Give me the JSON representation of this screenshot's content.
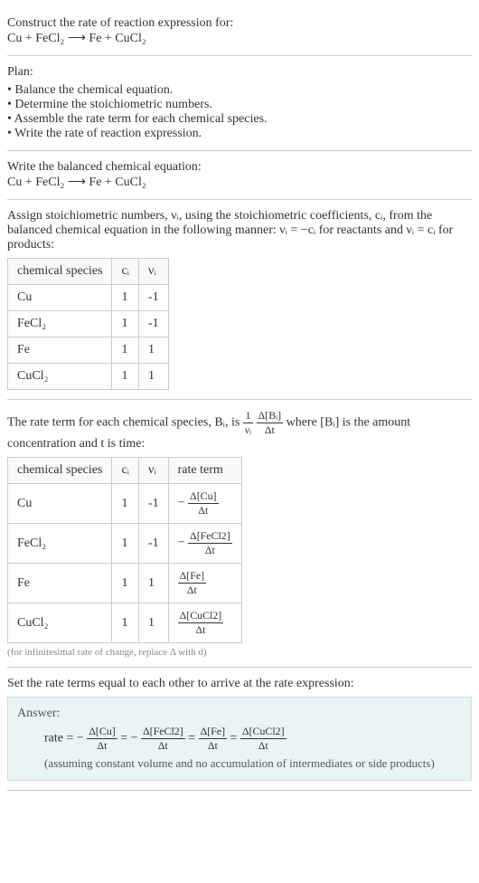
{
  "s1": {
    "title": "Construct the rate of reaction expression for:",
    "eq": "Cu + FeCl₂ ⟶ Fe + CuCl₂"
  },
  "s2": {
    "title": "Plan:",
    "items": [
      "Balance the chemical equation.",
      "Determine the stoichiometric numbers.",
      "Assemble the rate term for each chemical species.",
      "Write the rate of reaction expression."
    ]
  },
  "s3": {
    "title": "Write the balanced chemical equation:",
    "eq": "Cu + FeCl₂ ⟶ Fe + CuCl₂"
  },
  "s4": {
    "intro_a": "Assign stoichiometric numbers, νᵢ, using the stoichiometric coefficients, cᵢ, from the balanced chemical equation in the following manner: νᵢ = −cᵢ for reactants and νᵢ = cᵢ for products:",
    "headers": {
      "h1": "chemical species",
      "h2": "cᵢ",
      "h3": "νᵢ"
    },
    "rows": [
      {
        "sp": "Cu",
        "c": "1",
        "v": "-1"
      },
      {
        "sp": "FeCl₂",
        "c": "1",
        "v": "-1"
      },
      {
        "sp": "Fe",
        "c": "1",
        "v": "1"
      },
      {
        "sp": "CuCl₂",
        "c": "1",
        "v": "1"
      }
    ]
  },
  "s5": {
    "intro_a": "The rate term for each chemical species, Bᵢ, is ",
    "one_over_v_num": "1",
    "one_over_v_den": "νᵢ",
    "dB_num": "Δ[Bᵢ]",
    "dB_den": "Δt",
    "intro_b": " where [Bᵢ] is the amount concentration and t is time:",
    "headers": {
      "h1": "chemical species",
      "h2": "cᵢ",
      "h3": "νᵢ",
      "h4": "rate term"
    },
    "rows": [
      {
        "sp": "Cu",
        "c": "1",
        "v": "-1",
        "sign": "−",
        "num": "Δ[Cu]",
        "den": "Δt"
      },
      {
        "sp": "FeCl₂",
        "c": "1",
        "v": "-1",
        "sign": "−",
        "num": "Δ[FeCl2]",
        "den": "Δt"
      },
      {
        "sp": "Fe",
        "c": "1",
        "v": "1",
        "sign": "",
        "num": "Δ[Fe]",
        "den": "Δt"
      },
      {
        "sp": "CuCl₂",
        "c": "1",
        "v": "1",
        "sign": "",
        "num": "Δ[CuCl2]",
        "den": "Δt"
      }
    ],
    "note": "(for infinitesimal rate of change, replace Δ with d)"
  },
  "s6": {
    "title": "Set the rate terms equal to each other to arrive at the rate expression:",
    "answer_label": "Answer:",
    "eq_prefix": "rate = −",
    "t1_num": "Δ[Cu]",
    "t1_den": "Δt",
    "eq_sep1": " = −",
    "t2_num": "Δ[FeCl2]",
    "t2_den": "Δt",
    "eq_sep2": " = ",
    "t3_num": "Δ[Fe]",
    "t3_den": "Δt",
    "eq_sep3": " = ",
    "t4_num": "Δ[CuCl2]",
    "t4_den": "Δt",
    "assume": "(assuming constant volume and no accumulation of intermediates or side products)"
  }
}
